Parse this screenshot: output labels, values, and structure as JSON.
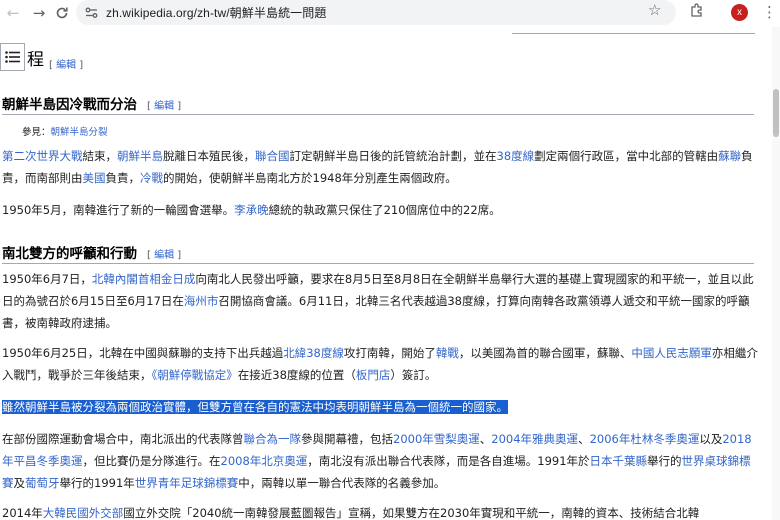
{
  "browser": {
    "url": "zh.wikipedia.org/zh-tw/朝鮮半島統一問題",
    "profile_initial": "x"
  },
  "page": {
    "heading_fragment": "程",
    "edit": "編輯",
    "sections": [
      {
        "title": "朝鮮半島因冷戰而分治"
      },
      {
        "title": "南北雙方的呼籲和行動"
      }
    ],
    "hatnote_prefix": "參見：",
    "hatnote_link": "朝鮮半島分裂",
    "p1": [
      {
        "t": "第二次世界大戰",
        "link": true
      },
      {
        "t": "結束，",
        "link": false
      },
      {
        "t": "朝鮮半島",
        "link": true
      },
      {
        "t": "脫離日本殖民後，",
        "link": false
      },
      {
        "t": "聯合國",
        "link": true
      },
      {
        "t": "訂定朝鮮半島日後的託管統治計劃，並在",
        "link": false
      },
      {
        "t": "38度線",
        "link": true
      },
      {
        "t": "劃定兩個行政區，當中北部的管轄由",
        "link": false
      },
      {
        "t": "蘇聯",
        "link": true
      },
      {
        "t": "負責，而南部則由",
        "link": false
      },
      {
        "t": "美國",
        "link": true
      },
      {
        "t": "負責，",
        "link": false
      },
      {
        "t": "冷戰",
        "link": true
      },
      {
        "t": "的開始，使朝鮮半島南北方於1948年分別產生兩個政府。",
        "link": false
      }
    ],
    "p2": [
      {
        "t": "1950年5月，南韓進行了新的一輪國會選舉。",
        "link": false
      },
      {
        "t": "李承晚",
        "link": true
      },
      {
        "t": "總統的執政黨只保住了210個席位中的22席。",
        "link": false
      }
    ],
    "p3": [
      {
        "t": "1950年6月7日，",
        "link": false
      },
      {
        "t": "北韓內閣首相金日成",
        "link": true
      },
      {
        "t": "向南北人民發出呼籲，要求在8月5日至8月8日在全朝鮮半島舉行大選的基礎上實現國家的和平統一，並且以此日的為號召於6月15日至6月17日在",
        "link": false
      },
      {
        "t": "海州市",
        "link": true
      },
      {
        "t": "召開協商會議。6月11日，北韓三名代表越過38度線，打算向南韓各政黨領導人遞交和平統一國家的呼籲書，被南韓政府逮捕。",
        "link": false
      }
    ],
    "p4": [
      {
        "t": "1950年6月25日，北韓在中國與蘇聯的支持下出兵越過",
        "link": false
      },
      {
        "t": "北緯38度線",
        "link": true
      },
      {
        "t": "攻打南韓，開始了",
        "link": false
      },
      {
        "t": "韓戰",
        "link": true
      },
      {
        "t": "，以美國為首的聯合國軍，蘇聯、",
        "link": false
      },
      {
        "t": "中國人民志願軍",
        "link": true
      },
      {
        "t": "亦相繼介入戰鬥，戰爭於三年後結束，",
        "link": false
      },
      {
        "t": "《朝鮮停戰協定》",
        "link": true
      },
      {
        "t": "在接近38度線的位置（",
        "link": false
      },
      {
        "t": "板門店",
        "link": true
      },
      {
        "t": "）簽訂。",
        "link": false
      }
    ],
    "p5_highlight": "雖然朝鮮半島被分裂為兩個政治實體，但雙方曾在各自的憲法中均表明朝鮮半島為一個統一的國家。",
    "p6": [
      {
        "t": "在部份國際運動會場合中，南北派出的代表隊曾",
        "link": false
      },
      {
        "t": "聯合為一隊",
        "link": true
      },
      {
        "t": "參與開幕禮，包括",
        "link": false
      },
      {
        "t": "2000年雪梨奧運",
        "link": true
      },
      {
        "t": "、",
        "link": false
      },
      {
        "t": "2004年雅典奧運",
        "link": true
      },
      {
        "t": "、",
        "link": false
      },
      {
        "t": "2006年杜林冬季奧運",
        "link": true
      },
      {
        "t": "以及",
        "link": false
      },
      {
        "t": "2018年平昌冬季奧運",
        "link": true
      },
      {
        "t": "，但比賽仍是分隊進行。在",
        "link": false
      },
      {
        "t": "2008年北京奧運",
        "link": true
      },
      {
        "t": "，南北沒有派出聯合代表隊，而是各自進場。1991年於",
        "link": false
      },
      {
        "t": "日本千葉縣",
        "link": true
      },
      {
        "t": "舉行的",
        "link": false
      },
      {
        "t": "世界桌球錦標賽",
        "link": true
      },
      {
        "t": "及",
        "link": false
      },
      {
        "t": "葡萄牙",
        "link": true
      },
      {
        "t": "舉行的1991年",
        "link": false
      },
      {
        "t": "世界青年足球錦標賽",
        "link": true
      },
      {
        "t": "中，兩韓以單一聯合代表隊的名義參加。",
        "link": false
      }
    ],
    "p7": [
      {
        "t": "2014年",
        "link": false
      },
      {
        "t": "大韓民國外交部",
        "link": true
      },
      {
        "t": "國立外交院「2040統一南韓發展藍圖報告」宣稱，如果雙方在2030年實現和平統一，南韓的資本、技術結合北韓",
        "link": false
      }
    ]
  }
}
